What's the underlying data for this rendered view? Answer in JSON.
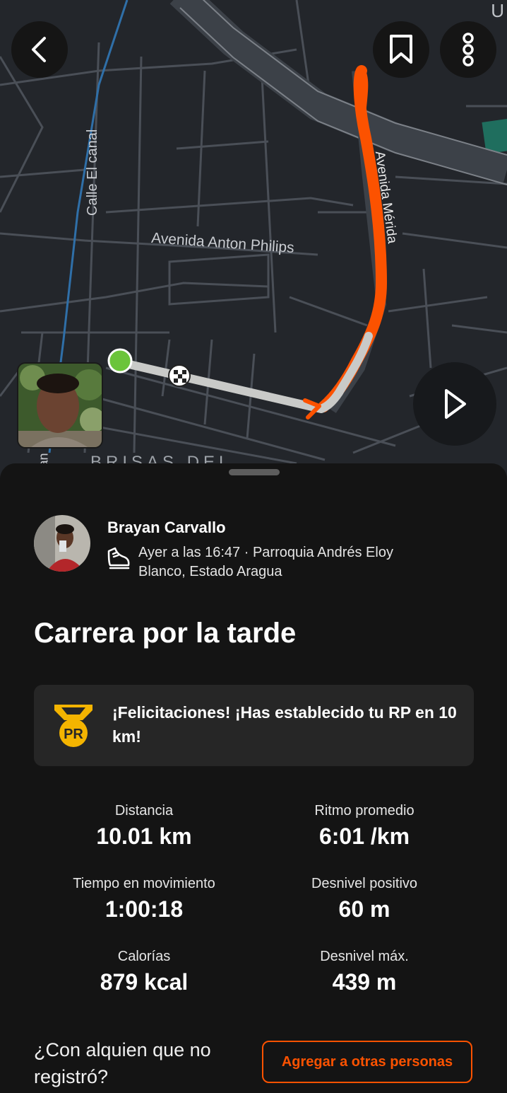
{
  "map": {
    "street_labels": [
      "Calle El canal",
      "Avenida Anton Philips",
      "Avenida Mérida",
      "BRISAS DEL",
      "an",
      "U"
    ],
    "route_color": "#fc5200",
    "start_marker_color": "#6bc43a",
    "photo_alt": "Foto de la actividad"
  },
  "icons": {
    "back": "chevron-left-icon",
    "bookmark": "bookmark-icon",
    "more": "more-vertical-icon",
    "play": "play-icon",
    "run": "running-shoe-icon",
    "pr": "pr-medal-icon"
  },
  "athlete": {
    "name": "Brayan Carvallo",
    "meta": "Ayer a las 16:47 · Parroquia Andrés Eloy Blanco, Estado Aragua"
  },
  "activity": {
    "title": "Carrera por la tarde"
  },
  "pr": {
    "badge_text": "PR",
    "message": "¡Felicitaciones! ¡Has establecido tu RP en 10 km!"
  },
  "stats": [
    {
      "label": "Distancia",
      "value": "10.01 km"
    },
    {
      "label": "Ritmo promedio",
      "value": "6:01 /km"
    },
    {
      "label": "Tiempo en movimiento",
      "value": "1:00:18"
    },
    {
      "label": "Desnivel positivo",
      "value": "60 m"
    },
    {
      "label": "Calorías",
      "value": "879 kcal"
    },
    {
      "label": "Desnivel máx.",
      "value": "439 m"
    }
  ],
  "tag_prompt": {
    "text": "¿Con alquien que no registró?",
    "button": "Agregar a otras personas"
  },
  "colors": {
    "accent": "#fc5200",
    "background": "#141414",
    "card": "#262626",
    "pr_gold": "#f4b400"
  }
}
